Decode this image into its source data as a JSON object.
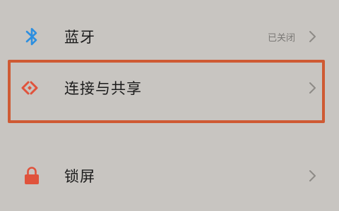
{
  "settings": {
    "items": [
      {
        "label": "蓝牙",
        "status": "已关闭",
        "icon": "bluetooth-icon",
        "icon_color": "#2d8fe0"
      },
      {
        "label": "连接与共享",
        "status": "",
        "icon": "connection-share-icon",
        "icon_color": "#e0533c",
        "highlighted": true
      },
      {
        "label": "锁屏",
        "status": "",
        "icon": "lock-icon",
        "icon_color": "#e0533c"
      }
    ]
  },
  "colors": {
    "background": "#c8c5c1",
    "highlight_border": "#cf5a33",
    "label_text": "#1c1c1c",
    "status_text": "#7a7875",
    "chevron": "#8d8a86"
  }
}
